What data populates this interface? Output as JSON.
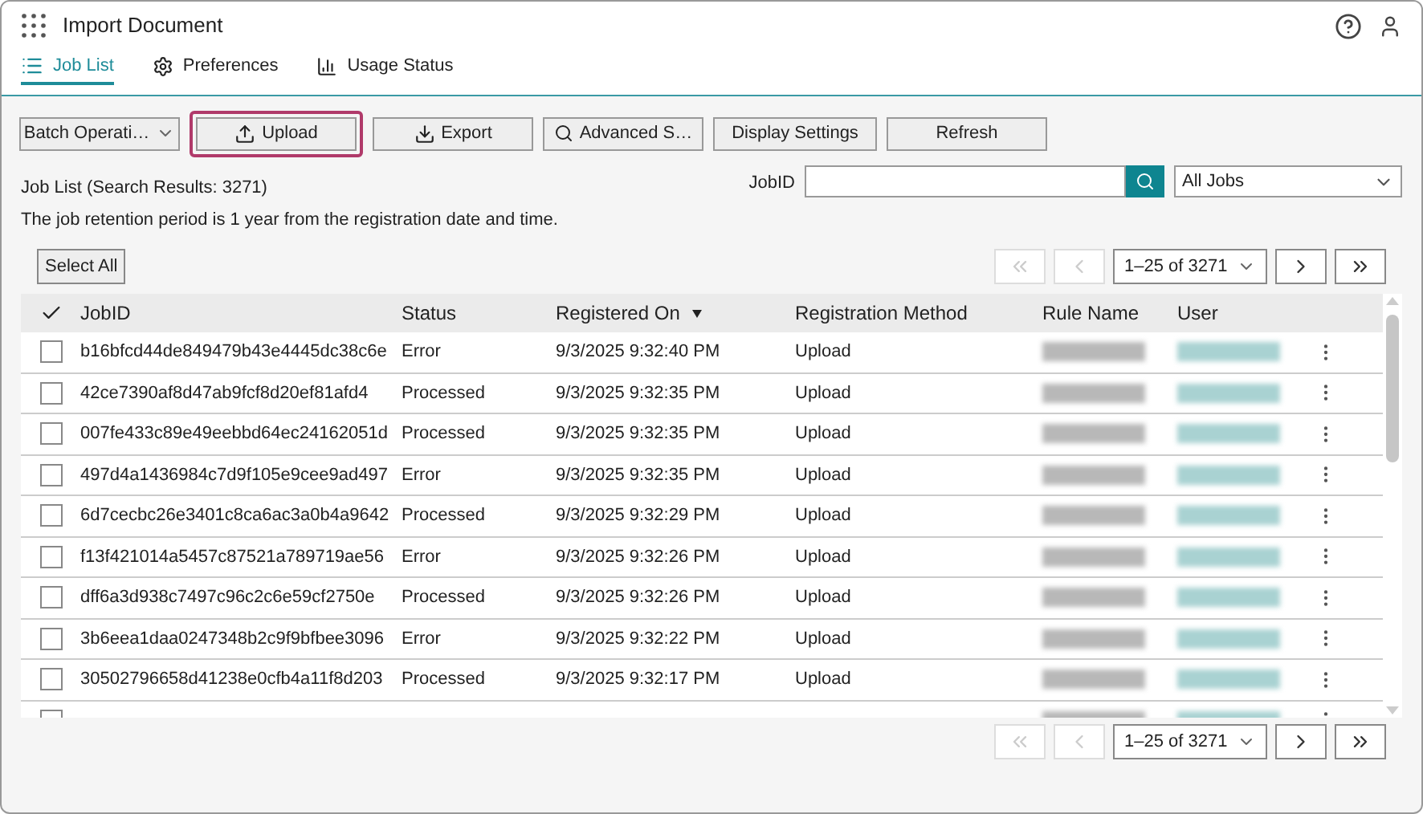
{
  "window": {
    "title": "Import Document"
  },
  "tabs": [
    {
      "label": "Job List",
      "selected": true
    },
    {
      "label": "Preferences",
      "selected": false
    },
    {
      "label": "Usage Status",
      "selected": false
    }
  ],
  "toolbar": [
    {
      "kind": "dropdown",
      "label": "Batch Operati…",
      "highlighted": false
    },
    {
      "kind": "upload",
      "label": "Upload",
      "highlighted": true
    },
    {
      "kind": "export",
      "label": "Export",
      "highlighted": false
    },
    {
      "kind": "search",
      "label": "Advanced S…",
      "highlighted": false
    },
    {
      "kind": "plain",
      "label": "Display Settings",
      "highlighted": false
    },
    {
      "kind": "plain",
      "label": "Refresh",
      "highlighted": false
    }
  ],
  "summary": {
    "results": "Job List (Search Results: 3271)",
    "note": "The job retention period is 1 year from the registration date and time."
  },
  "search": {
    "label": "JobID",
    "filter": "All Jobs"
  },
  "select_all": "Select All",
  "pagination_top": {
    "range": "1–25 of 3271"
  },
  "pagination_bottom": {
    "range": "1–25 of 3271"
  },
  "table": {
    "columns": [
      {
        "label": "JobID",
        "sorted": false
      },
      {
        "label": "Status",
        "sorted": false
      },
      {
        "label": "Registered On",
        "sorted": true
      },
      {
        "label": "Registration Method",
        "sorted": false
      },
      {
        "label": "Rule Name",
        "sorted": false
      },
      {
        "label": "User",
        "sorted": false
      }
    ],
    "rows": [
      {
        "job_id": "b16bfcd44de849479b43e4445dc38c6e",
        "status": "Error",
        "registered_on": "9/3/2025 9:32:40 PM",
        "method": "Upload",
        "checked": false,
        "redacted": true
      },
      {
        "job_id": "42ce7390af8d47ab9fcf8d20ef81afd4",
        "status": "Processed",
        "registered_on": "9/3/2025 9:32:35 PM",
        "method": "Upload",
        "checked": false,
        "redacted": true
      },
      {
        "job_id": "007fe433c89e49eebbd64ec24162051d",
        "status": "Processed",
        "registered_on": "9/3/2025 9:32:35 PM",
        "method": "Upload",
        "checked": false,
        "redacted": true
      },
      {
        "job_id": "497d4a1436984c7d9f105e9cee9ad497",
        "status": "Error",
        "registered_on": "9/3/2025 9:32:35 PM",
        "method": "Upload",
        "checked": false,
        "redacted": true
      },
      {
        "job_id": "6d7cecbc26e3401c8ca6ac3a0b4a9642",
        "status": "Processed",
        "registered_on": "9/3/2025 9:32:29 PM",
        "method": "Upload",
        "checked": false,
        "redacted": true
      },
      {
        "job_id": "f13f421014a5457c87521a789719ae56",
        "status": "Error",
        "registered_on": "9/3/2025 9:32:26 PM",
        "method": "Upload",
        "checked": false,
        "redacted": true
      },
      {
        "job_id": "dff6a3d938c7497c96c2c6e59cf2750e",
        "status": "Processed",
        "registered_on": "9/3/2025 9:32:26 PM",
        "method": "Upload",
        "checked": false,
        "redacted": true
      },
      {
        "job_id": "3b6eea1daa0247348b2c9f9bfbee3096",
        "status": "Error",
        "registered_on": "9/3/2025 9:32:22 PM",
        "method": "Upload",
        "checked": false,
        "redacted": true
      },
      {
        "job_id": "30502796658d41238e0cfb4a11f8d203",
        "status": "Processed",
        "registered_on": "9/3/2025 9:32:17 PM",
        "method": "Upload",
        "checked": false,
        "redacted": true
      },
      {
        "checked": false,
        "redacted": true
      }
    ]
  }
}
